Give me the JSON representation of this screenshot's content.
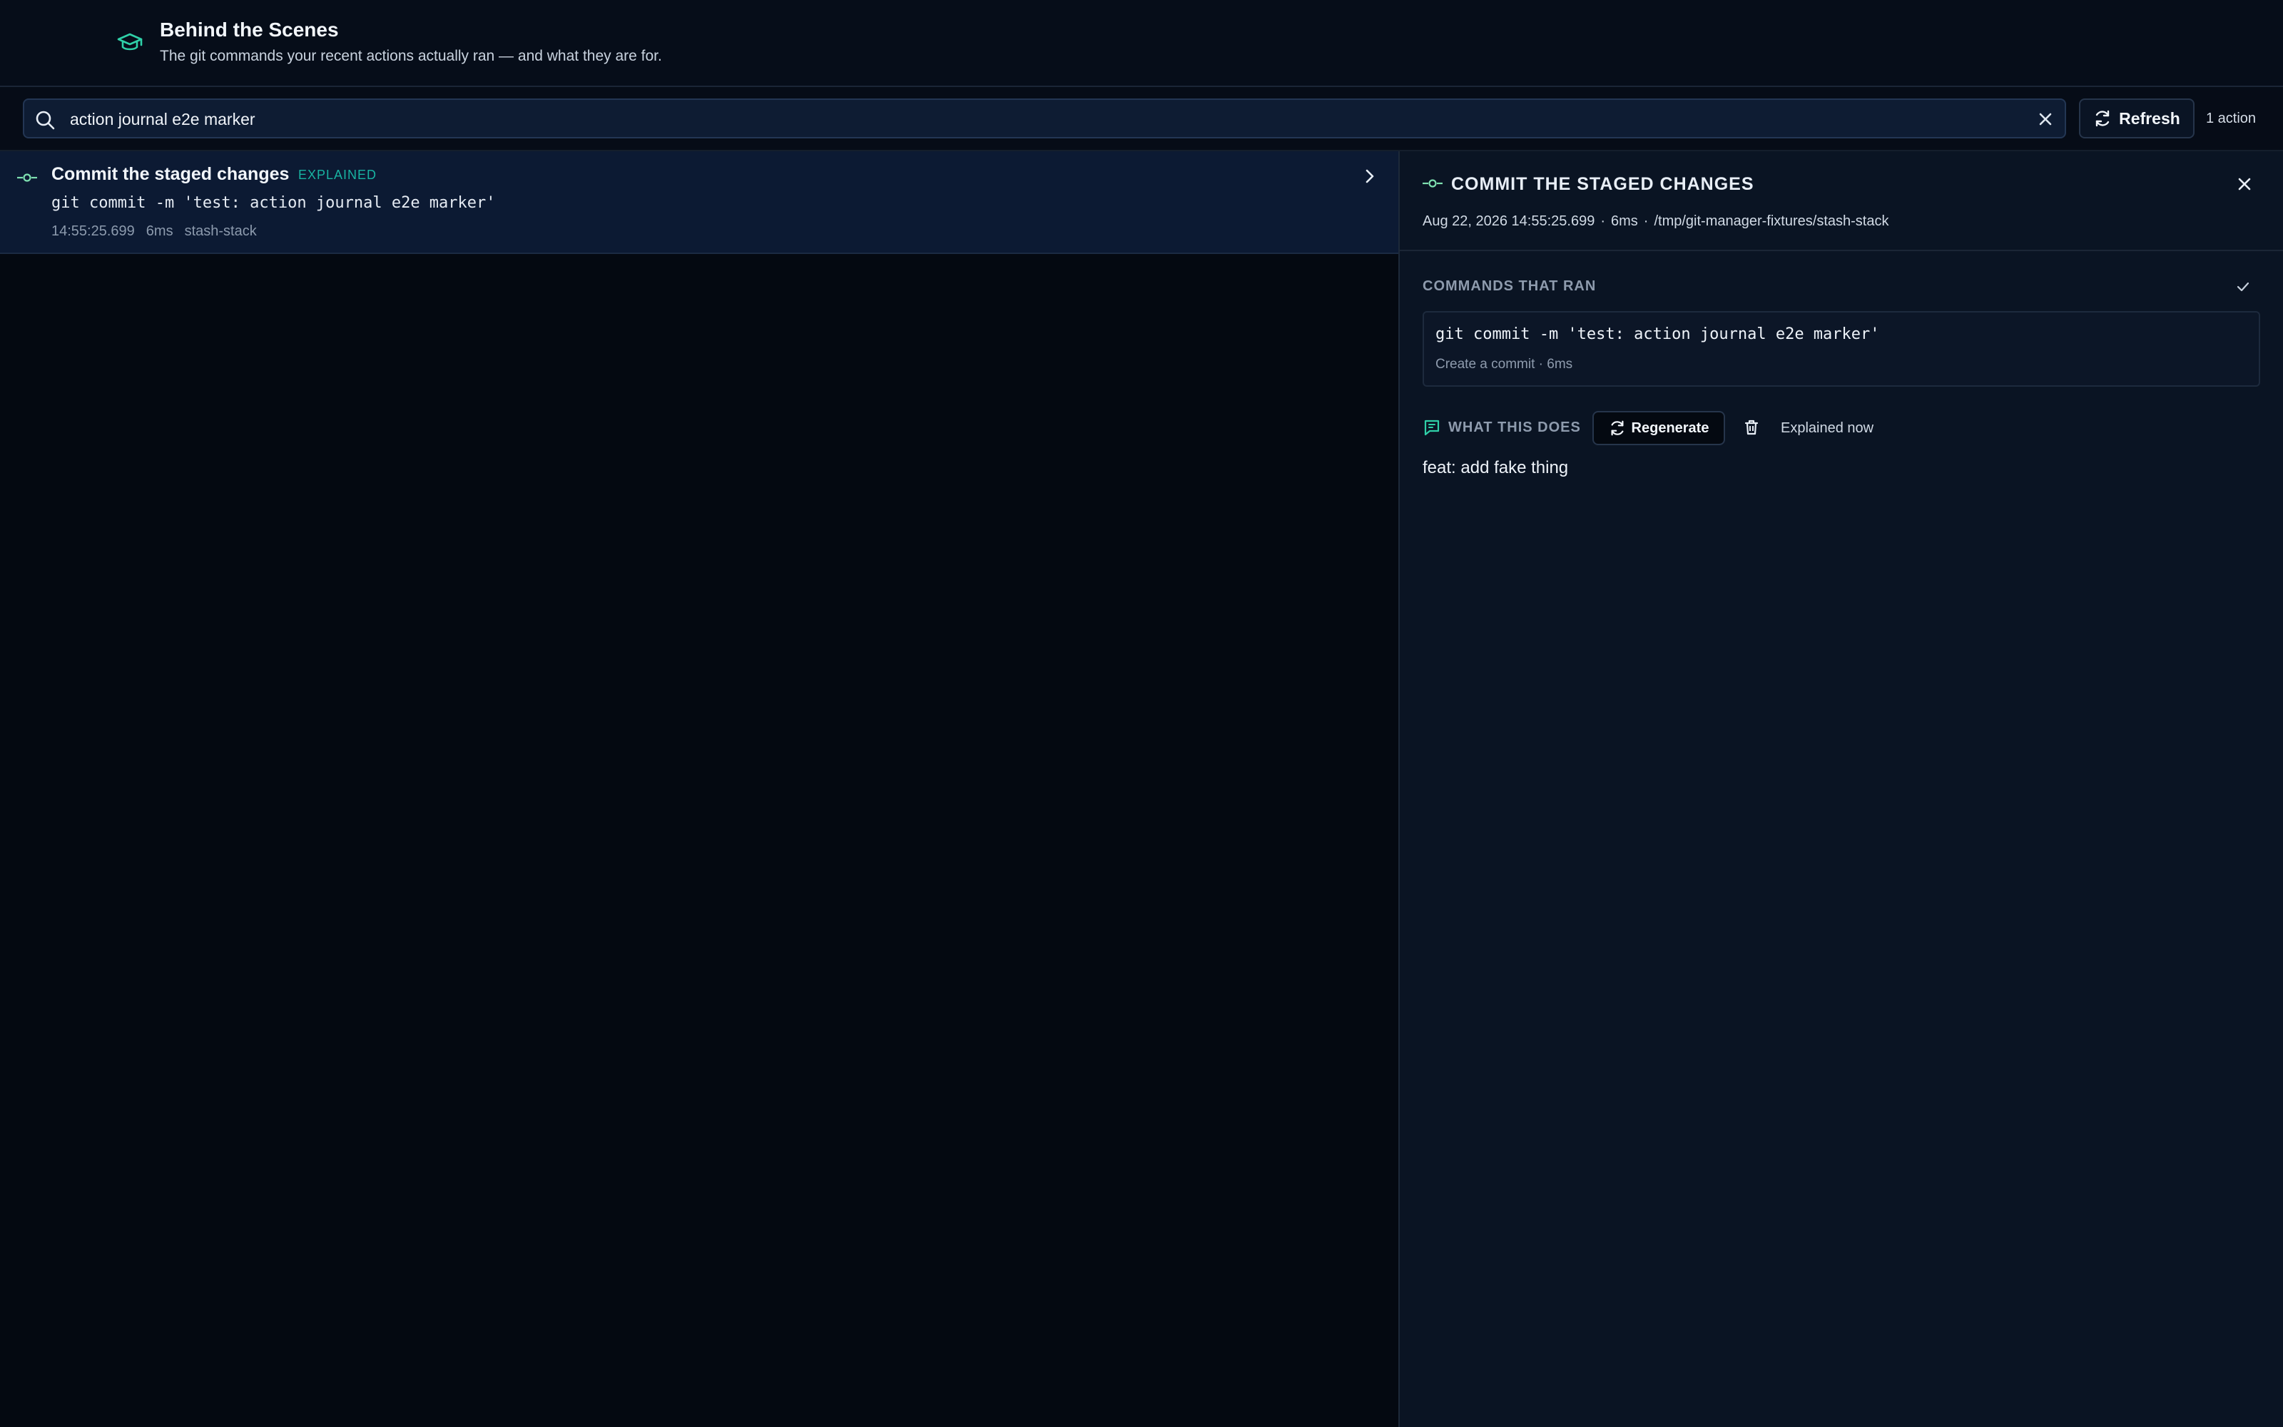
{
  "header": {
    "icon": "graduation-cap-icon",
    "title": "Behind the Scenes",
    "subtitle": "The git commands your recent actions actually ran — and what they are for."
  },
  "toolbar": {
    "search_value": "action journal e2e marker",
    "refresh_label": "Refresh",
    "count_label": "1 action"
  },
  "actions": [
    {
      "title": "Commit the staged changes",
      "badge": "EXPLAINED",
      "command": "git commit -m 'test: action journal e2e marker'",
      "time": "14:55:25.699",
      "duration": "6ms",
      "repo": "stash-stack"
    }
  ],
  "detail": {
    "title": "COMMIT THE STAGED CHANGES",
    "timestamp": "Aug 22, 2026 14:55:25.699",
    "duration": "6ms",
    "path": "/tmp/git-manager-fixtures/stash-stack",
    "separator": "·",
    "commands_label": "COMMANDS THAT RAN",
    "command": "git commit -m 'test: action journal e2e marker'",
    "command_desc": "Create a commit · 6ms",
    "what_label": "WHAT THIS DOES",
    "regenerate_label": "Regenerate",
    "explained_status": "Explained now",
    "explanation": "feat: add fake thing"
  },
  "colors": {
    "accent_teal": "#18b3a1",
    "commit_icon": "#7ee0b0",
    "background": "#040911",
    "selected_row": "#0c1a33"
  }
}
